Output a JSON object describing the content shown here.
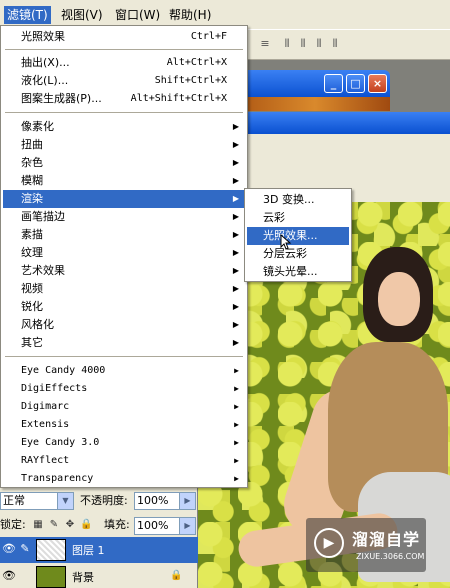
{
  "menubar": {
    "items": [
      {
        "label": "滤镜(T)"
      },
      {
        "label": "视图(V)"
      },
      {
        "label": "窗口(W)"
      },
      {
        "label": "帮助(H)"
      }
    ]
  },
  "filter_menu": {
    "last_filter": {
      "label": "光照效果",
      "shortcut": "Ctrl+F"
    },
    "extract": {
      "label": "抽出(X)...",
      "shortcut": "Alt+Ctrl+X"
    },
    "liquify": {
      "label": "液化(L)...",
      "shortcut": "Shift+Ctrl+X"
    },
    "pattern_maker": {
      "label": "图案生成器(P)...",
      "shortcut": "Alt+Shift+Ctrl+X"
    },
    "groups": [
      {
        "label": "像素化"
      },
      {
        "label": "扭曲"
      },
      {
        "label": "杂色"
      },
      {
        "label": "模糊"
      },
      {
        "label": "渲染"
      },
      {
        "label": "画笔描边"
      },
      {
        "label": "素描"
      },
      {
        "label": "纹理"
      },
      {
        "label": "艺术效果"
      },
      {
        "label": "视频"
      },
      {
        "label": "锐化"
      },
      {
        "label": "风格化"
      },
      {
        "label": "其它"
      }
    ],
    "plugins": [
      {
        "label": "Eye Candy 4000"
      },
      {
        "label": "DigiEffects"
      },
      {
        "label": "Digimarc"
      },
      {
        "label": "Extensis"
      },
      {
        "label": "Eye Candy 3.0"
      },
      {
        "label": "RAYflect"
      },
      {
        "label": "Transparency"
      }
    ]
  },
  "render_submenu": {
    "items": [
      {
        "label": "3D 变换..."
      },
      {
        "label": "云彩"
      },
      {
        "label": "光照效果..."
      },
      {
        "label": "分层云彩"
      },
      {
        "label": "镜头光晕..."
      }
    ]
  },
  "layers_panel": {
    "blend_mode": "正常",
    "opacity_label": "不透明度:",
    "opacity_value": "100%",
    "lock_label": "锁定:",
    "fill_label": "填充:",
    "fill_value": "100%",
    "layers": [
      {
        "name": "图层 1"
      },
      {
        "name": "背景"
      }
    ]
  },
  "watermark": {
    "title": "溜溜自学",
    "url": "ZIXUE.3066.COM"
  },
  "colors": {
    "highlight": "#316ac5",
    "menu_bg": "#ffffff",
    "chrome_bg": "#ece9d8"
  }
}
